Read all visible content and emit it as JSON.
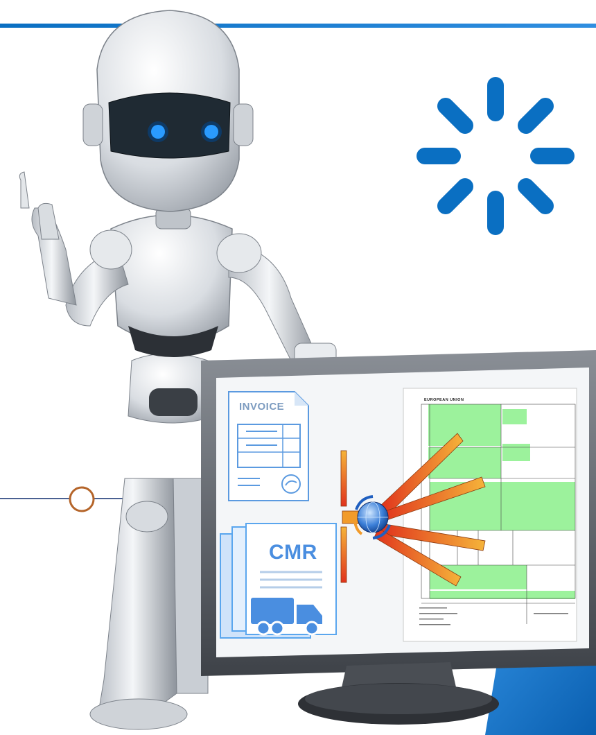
{
  "documents": {
    "invoice_label": "INVOICE",
    "cmr_label": "CMR",
    "customs_form_heading": "EUROPEAN UNION"
  },
  "icons": [
    "loading-spinner-icon",
    "robot-figure",
    "monitor",
    "invoice-document-icon",
    "cmr-document-icon",
    "truck-icon",
    "globe-icon",
    "timeline-node-icon"
  ],
  "colors": {
    "brand_blue": "#0a6fc2",
    "form_green": "#9cf29c",
    "arrow_orange": "#f29b2a",
    "arrow_red": "#e0321c",
    "node_brown": "#b5652a",
    "line_navy": "#0f2d6e"
  }
}
